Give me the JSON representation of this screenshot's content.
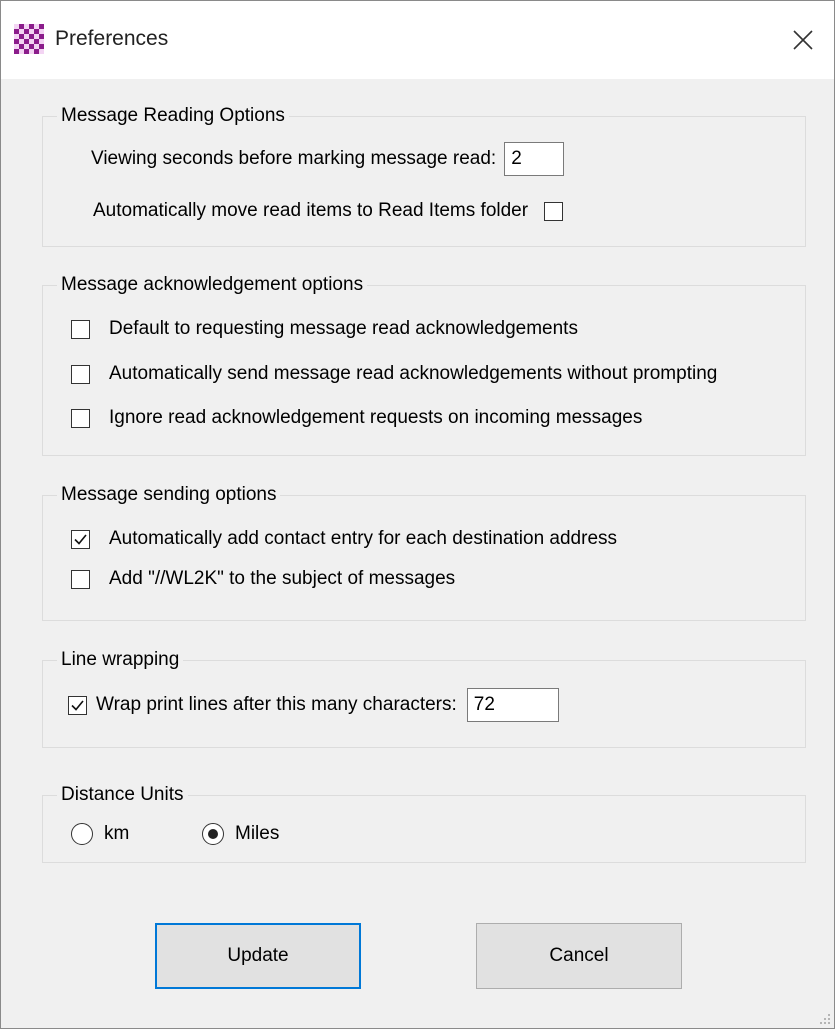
{
  "window": {
    "title": "Preferences",
    "app_icon": "checkered-purple-icon",
    "close_icon": "close-icon"
  },
  "reading": {
    "legend": "Message Reading Options",
    "viewing_label": "Viewing seconds before marking message read:",
    "viewing_value": "2",
    "auto_move_label": "Automatically move read items to Read Items folder",
    "auto_move_checked": false
  },
  "ack": {
    "legend": "Message acknowledgement options",
    "items": [
      {
        "label": "Default to requesting message read acknowledgements",
        "checked": false
      },
      {
        "label": "Automatically send message read acknowledgements without prompting",
        "checked": false
      },
      {
        "label": "Ignore read acknowledgement requests on incoming messages",
        "checked": false
      }
    ]
  },
  "sending": {
    "legend": "Message sending options",
    "items": [
      {
        "label": "Automatically add contact entry for each destination address",
        "checked": true
      },
      {
        "label": "Add \"//WL2K\" to the subject of messages",
        "checked": false
      }
    ]
  },
  "wrapping": {
    "legend": "Line wrapping",
    "label": "Wrap print lines after this many characters:",
    "checked": true,
    "value": "72"
  },
  "distance": {
    "legend": "Distance Units",
    "options": [
      {
        "label": "km",
        "selected": false
      },
      {
        "label": "Miles",
        "selected": true
      }
    ]
  },
  "buttons": {
    "update": "Update",
    "cancel": "Cancel"
  },
  "colors": {
    "accent": "#0078d7",
    "dialog_bg": "#f0f0f0"
  }
}
